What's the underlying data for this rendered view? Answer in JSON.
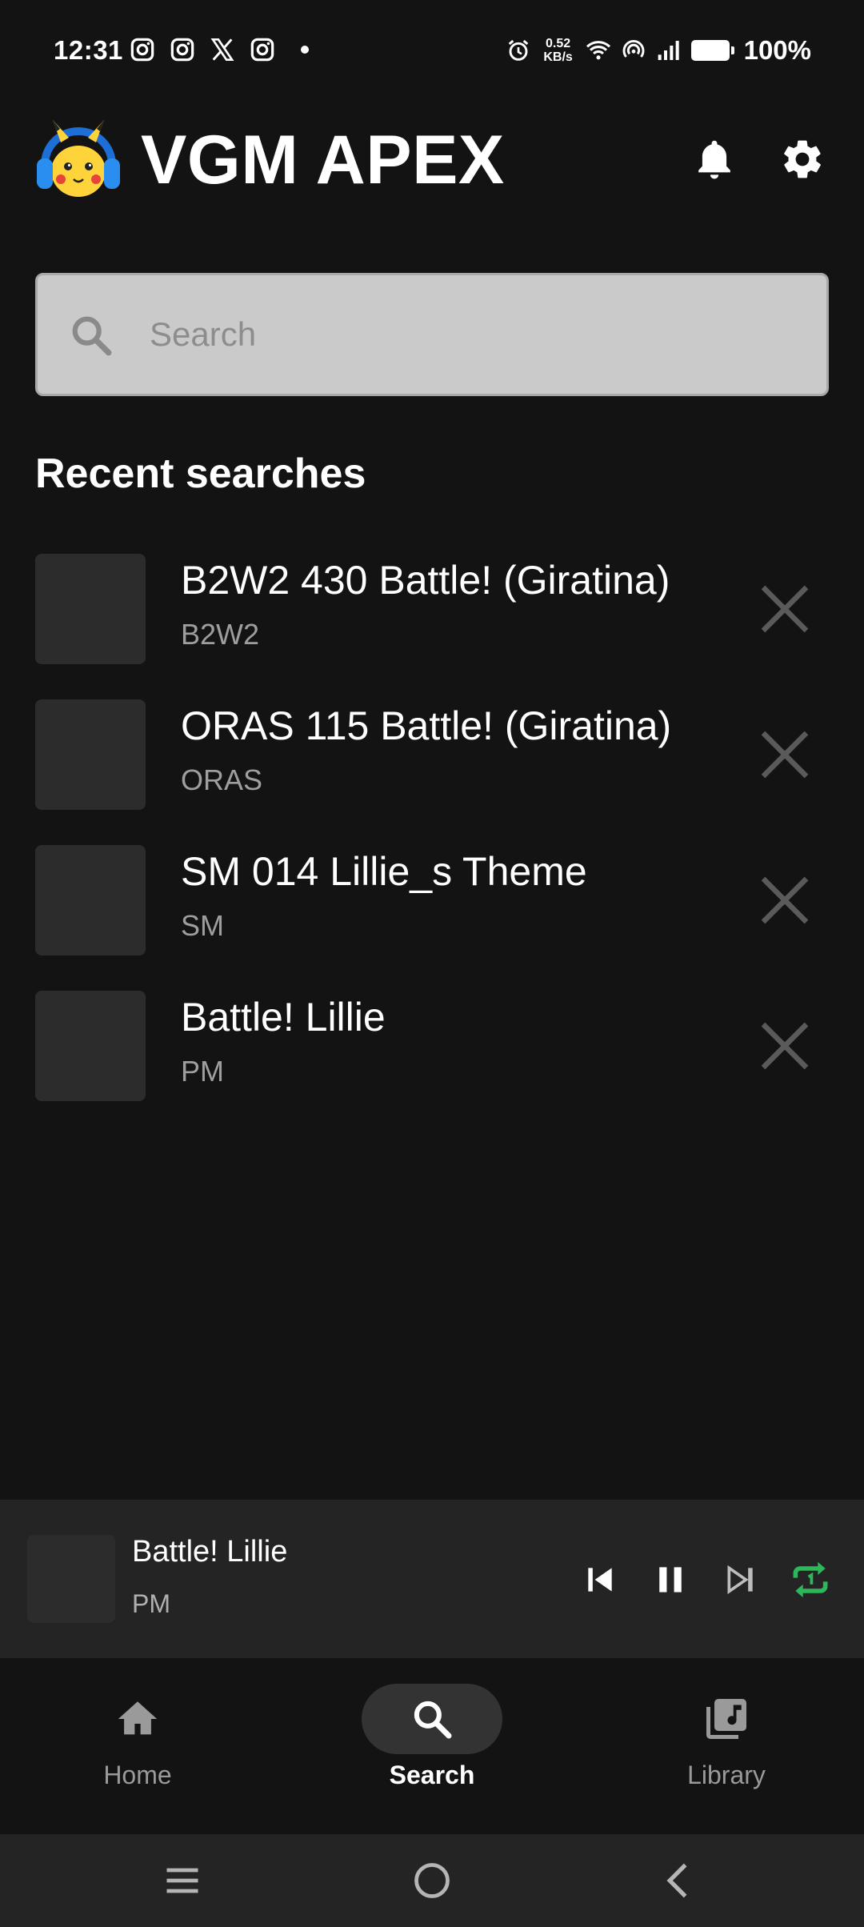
{
  "status_bar": {
    "time": "12:31",
    "net_speed_value": "0.52",
    "net_speed_unit": "KB/s",
    "battery": "100%",
    "left_icons": [
      "instagram-icon",
      "instagram-icon",
      "x-icon",
      "instagram-icon",
      "dot-icon"
    ],
    "right_icons": [
      "alarm-icon",
      "wifi-icon",
      "hotspot-icon",
      "signal-icon",
      "battery-icon"
    ]
  },
  "header": {
    "title": "VGM APEX",
    "logo": "pikachu-headphones-logo",
    "actions": [
      "bell-icon",
      "gear-icon"
    ]
  },
  "search": {
    "placeholder": "Search",
    "value": ""
  },
  "recent": {
    "title": "Recent searches",
    "items": [
      {
        "title": "B2W2 430 Battle! (Giratina)",
        "subtitle": "B2W2"
      },
      {
        "title": "ORAS 115 Battle! (Giratina)",
        "subtitle": "ORAS"
      },
      {
        "title": "SM 014 Lillie_s Theme",
        "subtitle": "SM"
      },
      {
        "title": "Battle! Lillie",
        "subtitle": "PM"
      }
    ]
  },
  "player": {
    "title": "Battle! Lillie",
    "subtitle": "PM",
    "repeat_mode": "repeat-one",
    "accent_color": "#2db75a",
    "state": "playing"
  },
  "nav": {
    "home": "Home",
    "search": "Search",
    "library": "Library",
    "active": "search"
  },
  "colors": {
    "background": "#131313",
    "surface": "#242424",
    "search_box": "#cacaca",
    "accent_green": "#2db75a"
  }
}
